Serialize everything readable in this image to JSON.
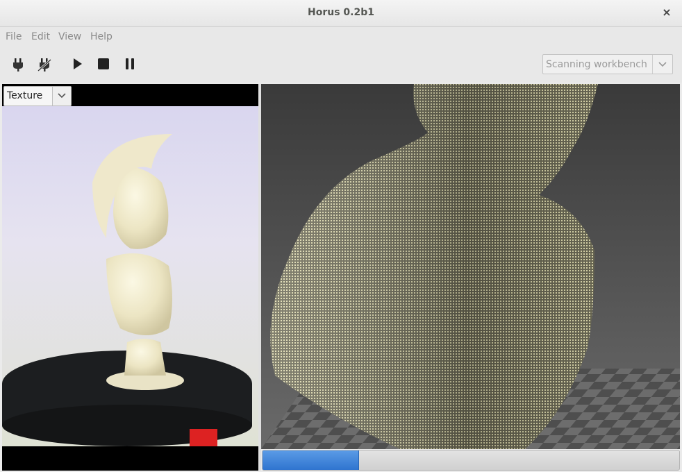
{
  "window": {
    "title": "Horus 0.2b1",
    "close_glyph": "×"
  },
  "menu": {
    "items": [
      "File",
      "Edit",
      "View",
      "Help"
    ]
  },
  "toolbar": {
    "buttons": [
      {
        "name": "connect-icon"
      },
      {
        "name": "disconnect-icon"
      },
      {
        "name": "play-icon"
      },
      {
        "name": "stop-icon"
      },
      {
        "name": "pause-icon"
      }
    ],
    "workbench_select": "Scanning workbench"
  },
  "camera_panel": {
    "view_select": "Texture"
  },
  "scan_progress": {
    "fraction": 0.23
  },
  "colors": {
    "progress": "#3b82d6",
    "point_cloud": "#d8d4a8",
    "turntable": "#222426"
  }
}
